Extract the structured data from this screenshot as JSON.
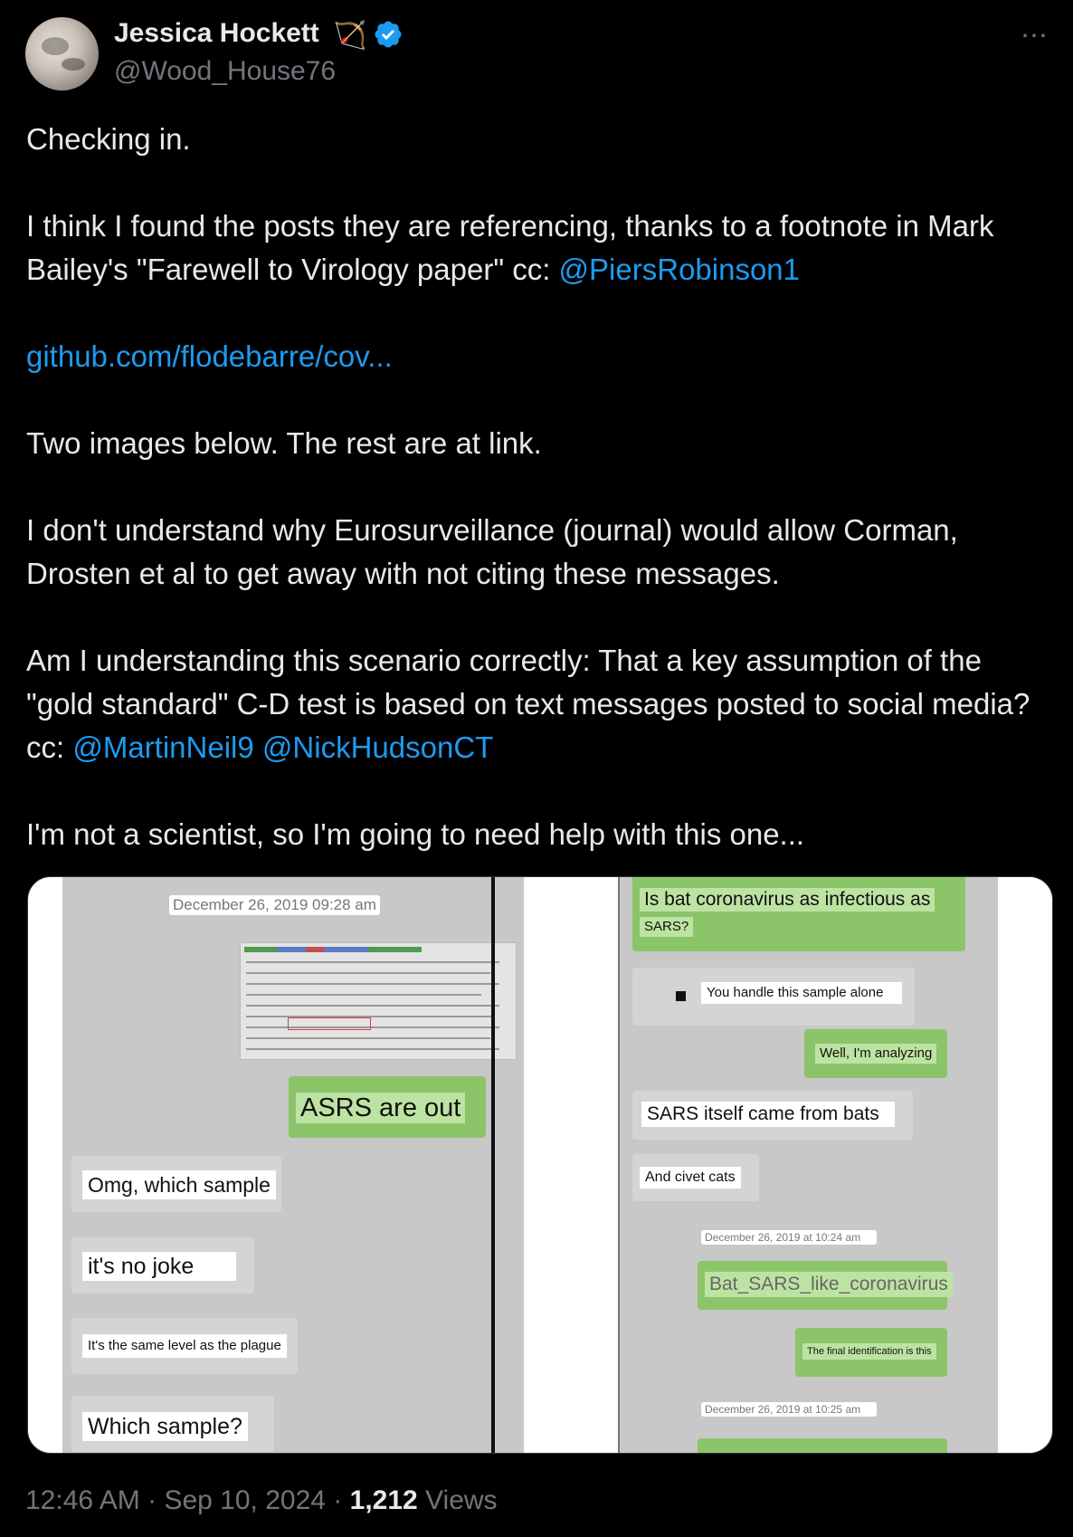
{
  "author": {
    "name": "Jessica Hockett",
    "emoji": "🏹",
    "handle": "@Wood_House76",
    "verified": true
  },
  "more_icon": "⋯",
  "tweet": {
    "p1": "Checking in.",
    "p2_pre": "I think I found the posts they are referencing, thanks to a footnote in Mark Bailey's \"Farewell to Virology paper\" cc: ",
    "p2_mention": "@PiersRobinson1",
    "p3_link": "github.com/flodebarre/cov...",
    "p4": "Two images below. The rest are at link.",
    "p5": "I don't understand why Eurosurveillance (journal) would allow Corman, Drosten et al to get away with not citing these messages.",
    "p6_pre": "Am I understanding this scenario correctly: That a key assumption of the \"gold standard\" C-D test is based on text messages posted to social media? cc: ",
    "p6_mention1": "@MartinNeil9",
    "p6_mention2": "@NickHudsonCT",
    "p7": "I'm not a scientist, so I'm going to need help with this one..."
  },
  "media": {
    "left": {
      "timestamp": "December 26, 2019 09:28 am",
      "out_msg": "ASRS are out",
      "in_msgs": [
        "Omg, which sample",
        "it's no joke",
        "It's the same level as the plague",
        "Which sample?"
      ]
    },
    "right": {
      "out_top_line1": "Is bat coronavirus as infectious as",
      "out_top_line2": "SARS?",
      "in1": "You handle this sample alone",
      "out1": "Well, I'm analyzing",
      "in2": "SARS itself came from bats",
      "in3": "And civet cats",
      "timestamp1": "December 26, 2019 at 10:24 am",
      "out2": "Bat_SARS_like_coronavirus",
      "out3": "The final identification is this",
      "timestamp2": "December 26, 2019 at 10:25 am"
    }
  },
  "footer": {
    "time": "12:46 AM",
    "date": "Sep 10, 2024",
    "views_count": "1,212",
    "views_label": "Views",
    "sep": "·"
  },
  "colors": {
    "accent": "#1d9bf0",
    "text": "#e7e9ea",
    "muted": "#71767b",
    "bg": "#000000",
    "bubble_out": "#8cc46a"
  }
}
